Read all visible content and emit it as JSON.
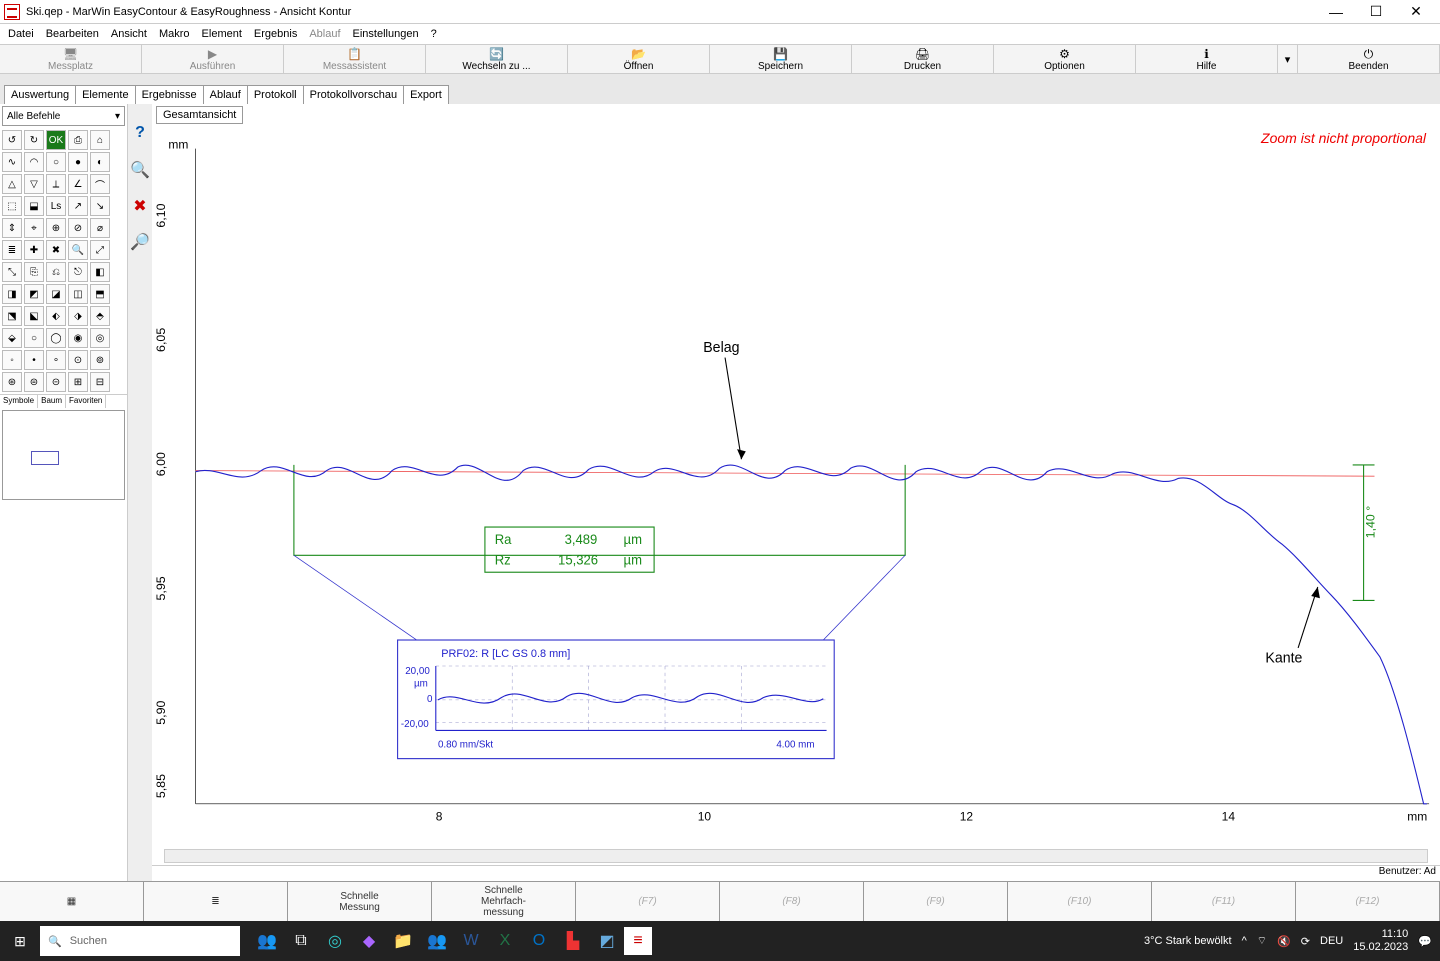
{
  "window": {
    "title": "Ski.qep - MarWin EasyContour & EasyRoughness - Ansicht Kontur"
  },
  "menu": [
    "Datei",
    "Bearbeiten",
    "Ansicht",
    "Makro",
    "Element",
    "Ergebnis",
    "Ablauf",
    "Einstellungen",
    "?"
  ],
  "toolbar": [
    {
      "label": "Messplatz",
      "icon": "🖥",
      "dim": true
    },
    {
      "label": "Ausführen",
      "icon": "▶",
      "dim": true
    },
    {
      "label": "Messassistent",
      "icon": "📋",
      "dim": true
    },
    {
      "label": "Wechseln zu ...",
      "icon": "🔄",
      "dim": false
    },
    {
      "label": "Öffnen",
      "icon": "📂",
      "dim": false
    },
    {
      "label": "Speichern",
      "icon": "💾",
      "dim": false
    },
    {
      "label": "Drucken",
      "icon": "🖨",
      "dim": false
    },
    {
      "label": "Optionen",
      "icon": "⚙",
      "dim": false
    },
    {
      "label": "Hilfe",
      "icon": "ℹ",
      "dim": false
    },
    {
      "label": "Beenden",
      "icon": "⏻",
      "dim": false
    }
  ],
  "tabs": [
    "Auswertung",
    "Elemente",
    "Ergebnisse",
    "Ablauf",
    "Protokoll",
    "Protokollvorschau",
    "Export"
  ],
  "left": {
    "combo": "Alle Befehle",
    "mini_tabs": [
      "Symbole",
      "Baum",
      "Favoriten"
    ]
  },
  "chart": {
    "view_button": "Gesamtansicht",
    "zoom_warning": "Zoom ist nicht proportional",
    "y_unit": "mm",
    "x_unit": "mm",
    "y_ticks": [
      "6,10",
      "6,05",
      "6,00",
      "5,95",
      "5,90",
      "5,85"
    ],
    "x_ticks": [
      "8",
      "10",
      "12",
      "14"
    ],
    "annotations": {
      "belag": "Belag",
      "kante": "Kante",
      "angle": "1,40 °"
    },
    "roughness_box": {
      "rows": [
        {
          "name": "Ra",
          "value": "3,489",
          "unit": "µm"
        },
        {
          "name": "Rz",
          "value": "15,326",
          "unit": "µm"
        }
      ]
    },
    "inset": {
      "title": "PRF02: R [LC GS 0.8 mm]",
      "y_top": "20,00",
      "y_unit": "µm",
      "y_mid": "0",
      "y_bot": "-20,00",
      "x_left": "0.80 mm/Skt",
      "x_right": "4.00 mm"
    }
  },
  "chart_data": {
    "type": "line",
    "xlabel": "mm",
    "ylabel": "mm",
    "xlim": [
      6,
      15.5
    ],
    "ylim": [
      5.83,
      6.12
    ],
    "annotations": [
      {
        "label": "Belag",
        "x": 10.0,
        "y": 6.0
      },
      {
        "label": "Kante",
        "x": 14.4,
        "y": 5.97
      }
    ],
    "roughness": {
      "Ra_um": 3.489,
      "Rz_um": 15.326
    },
    "angle_deg": 1.4,
    "grid": false,
    "note": "Main profile is a roughness trace around y≈6.00 mm from x≈6 to ≈13.5 mm, then a descending edge to x≈15.3, y≈5.84. Inset shows filtered roughness ±20 µm over 4 mm span.",
    "inset": {
      "type": "line",
      "ylim_um": [
        -20,
        20
      ],
      "x_span_mm": 4.0,
      "x_per_div_mm": 0.8
    }
  },
  "status": {
    "user": "Benutzer: Ad"
  },
  "fkeys": [
    {
      "label": "",
      "icon": "▦"
    },
    {
      "label": "",
      "icon": "≣"
    },
    {
      "label": "Schnelle\nMessung"
    },
    {
      "label": "Schnelle\nMehrfach-\nmessung"
    },
    {
      "label": "(F7)",
      "dim": true
    },
    {
      "label": "(F8)",
      "dim": true
    },
    {
      "label": "(F9)",
      "dim": true
    },
    {
      "label": "(F10)",
      "dim": true
    },
    {
      "label": "(F11)",
      "dim": true
    },
    {
      "label": "(F12)",
      "dim": true
    }
  ],
  "taskbar": {
    "search_placeholder": "Suchen",
    "weather": "3°C  Stark bewölkt",
    "lang": "DEU",
    "time": "11:10",
    "date": "15.02.2023"
  }
}
